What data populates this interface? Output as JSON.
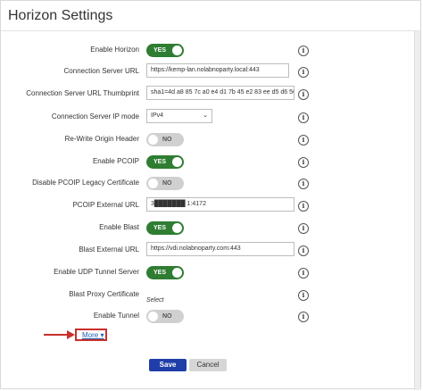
{
  "dialog": {
    "title": "Horizon Settings"
  },
  "rows": [
    {
      "label": "Enable Horizon",
      "type": "toggle",
      "state": "YES"
    },
    {
      "label": "Connection Server URL",
      "type": "text",
      "value": "https://kemp-lan.nolabnoparty.local:443"
    },
    {
      "label": "Connection Server URL Thumbprint",
      "type": "text",
      "value": "sha1=4d a8 85 7c a0 e4 d1 7b 45 e2 83 ee d5 d6 5C"
    },
    {
      "label": "Connection Server IP mode",
      "type": "select",
      "value": "IPv4"
    },
    {
      "label": "Re-Write Origin Header",
      "type": "toggle",
      "state": "NO"
    },
    {
      "label": "Enable PCOIP",
      "type": "toggle",
      "state": "YES"
    },
    {
      "label": "Disable PCOIP Legacy Certificate",
      "type": "toggle",
      "state": "NO"
    },
    {
      "label": "PCOIP External URL",
      "type": "text",
      "value": "3███████ 1:4172"
    },
    {
      "label": "Enable Blast",
      "type": "toggle",
      "state": "YES"
    },
    {
      "label": "Blast External URL",
      "type": "text",
      "value": "https://vdi.nolabnoparty.com:443"
    },
    {
      "label": "Enable UDP Tunnel Server",
      "type": "toggle",
      "state": "YES"
    },
    {
      "label": "Blast Proxy Certificate",
      "type": "select_link",
      "value": "Select"
    },
    {
      "label": "Enable Tunnel",
      "type": "toggle",
      "state": "NO"
    }
  ],
  "more": {
    "label": "More ▾"
  },
  "buttons": {
    "save": "Save",
    "cancel": "Cancel"
  },
  "info_glyph": "i",
  "colors": {
    "toggle_on": "#2f7d32",
    "toggle_off": "#d0d0d0",
    "save_button": "#1f3ea8",
    "annotation": "#c9302c",
    "link": "#1a5fb4"
  }
}
